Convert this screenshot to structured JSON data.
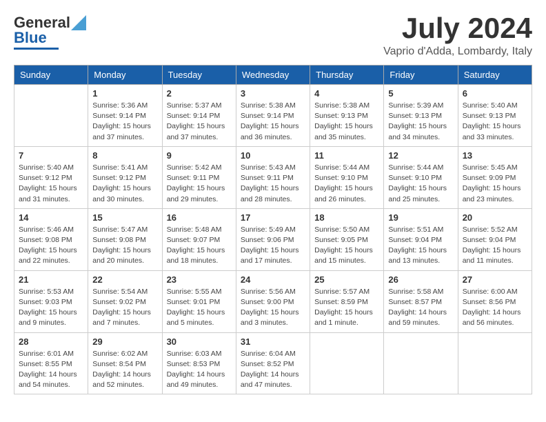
{
  "header": {
    "logo_general": "General",
    "logo_blue": "Blue",
    "month_title": "July 2024",
    "location": "Vaprio d'Adda, Lombardy, Italy"
  },
  "columns": [
    "Sunday",
    "Monday",
    "Tuesday",
    "Wednesday",
    "Thursday",
    "Friday",
    "Saturday"
  ],
  "weeks": [
    [
      {
        "day": "",
        "info": ""
      },
      {
        "day": "1",
        "info": "Sunrise: 5:36 AM\nSunset: 9:14 PM\nDaylight: 15 hours\nand 37 minutes."
      },
      {
        "day": "2",
        "info": "Sunrise: 5:37 AM\nSunset: 9:14 PM\nDaylight: 15 hours\nand 37 minutes."
      },
      {
        "day": "3",
        "info": "Sunrise: 5:38 AM\nSunset: 9:14 PM\nDaylight: 15 hours\nand 36 minutes."
      },
      {
        "day": "4",
        "info": "Sunrise: 5:38 AM\nSunset: 9:13 PM\nDaylight: 15 hours\nand 35 minutes."
      },
      {
        "day": "5",
        "info": "Sunrise: 5:39 AM\nSunset: 9:13 PM\nDaylight: 15 hours\nand 34 minutes."
      },
      {
        "day": "6",
        "info": "Sunrise: 5:40 AM\nSunset: 9:13 PM\nDaylight: 15 hours\nand 33 minutes."
      }
    ],
    [
      {
        "day": "7",
        "info": "Sunrise: 5:40 AM\nSunset: 9:12 PM\nDaylight: 15 hours\nand 31 minutes."
      },
      {
        "day": "8",
        "info": "Sunrise: 5:41 AM\nSunset: 9:12 PM\nDaylight: 15 hours\nand 30 minutes."
      },
      {
        "day": "9",
        "info": "Sunrise: 5:42 AM\nSunset: 9:11 PM\nDaylight: 15 hours\nand 29 minutes."
      },
      {
        "day": "10",
        "info": "Sunrise: 5:43 AM\nSunset: 9:11 PM\nDaylight: 15 hours\nand 28 minutes."
      },
      {
        "day": "11",
        "info": "Sunrise: 5:44 AM\nSunset: 9:10 PM\nDaylight: 15 hours\nand 26 minutes."
      },
      {
        "day": "12",
        "info": "Sunrise: 5:44 AM\nSunset: 9:10 PM\nDaylight: 15 hours\nand 25 minutes."
      },
      {
        "day": "13",
        "info": "Sunrise: 5:45 AM\nSunset: 9:09 PM\nDaylight: 15 hours\nand 23 minutes."
      }
    ],
    [
      {
        "day": "14",
        "info": "Sunrise: 5:46 AM\nSunset: 9:08 PM\nDaylight: 15 hours\nand 22 minutes."
      },
      {
        "day": "15",
        "info": "Sunrise: 5:47 AM\nSunset: 9:08 PM\nDaylight: 15 hours\nand 20 minutes."
      },
      {
        "day": "16",
        "info": "Sunrise: 5:48 AM\nSunset: 9:07 PM\nDaylight: 15 hours\nand 18 minutes."
      },
      {
        "day": "17",
        "info": "Sunrise: 5:49 AM\nSunset: 9:06 PM\nDaylight: 15 hours\nand 17 minutes."
      },
      {
        "day": "18",
        "info": "Sunrise: 5:50 AM\nSunset: 9:05 PM\nDaylight: 15 hours\nand 15 minutes."
      },
      {
        "day": "19",
        "info": "Sunrise: 5:51 AM\nSunset: 9:04 PM\nDaylight: 15 hours\nand 13 minutes."
      },
      {
        "day": "20",
        "info": "Sunrise: 5:52 AM\nSunset: 9:04 PM\nDaylight: 15 hours\nand 11 minutes."
      }
    ],
    [
      {
        "day": "21",
        "info": "Sunrise: 5:53 AM\nSunset: 9:03 PM\nDaylight: 15 hours\nand 9 minutes."
      },
      {
        "day": "22",
        "info": "Sunrise: 5:54 AM\nSunset: 9:02 PM\nDaylight: 15 hours\nand 7 minutes."
      },
      {
        "day": "23",
        "info": "Sunrise: 5:55 AM\nSunset: 9:01 PM\nDaylight: 15 hours\nand 5 minutes."
      },
      {
        "day": "24",
        "info": "Sunrise: 5:56 AM\nSunset: 9:00 PM\nDaylight: 15 hours\nand 3 minutes."
      },
      {
        "day": "25",
        "info": "Sunrise: 5:57 AM\nSunset: 8:59 PM\nDaylight: 15 hours\nand 1 minute."
      },
      {
        "day": "26",
        "info": "Sunrise: 5:58 AM\nSunset: 8:57 PM\nDaylight: 14 hours\nand 59 minutes."
      },
      {
        "day": "27",
        "info": "Sunrise: 6:00 AM\nSunset: 8:56 PM\nDaylight: 14 hours\nand 56 minutes."
      }
    ],
    [
      {
        "day": "28",
        "info": "Sunrise: 6:01 AM\nSunset: 8:55 PM\nDaylight: 14 hours\nand 54 minutes."
      },
      {
        "day": "29",
        "info": "Sunrise: 6:02 AM\nSunset: 8:54 PM\nDaylight: 14 hours\nand 52 minutes."
      },
      {
        "day": "30",
        "info": "Sunrise: 6:03 AM\nSunset: 8:53 PM\nDaylight: 14 hours\nand 49 minutes."
      },
      {
        "day": "31",
        "info": "Sunrise: 6:04 AM\nSunset: 8:52 PM\nDaylight: 14 hours\nand 47 minutes."
      },
      {
        "day": "",
        "info": ""
      },
      {
        "day": "",
        "info": ""
      },
      {
        "day": "",
        "info": ""
      }
    ]
  ]
}
